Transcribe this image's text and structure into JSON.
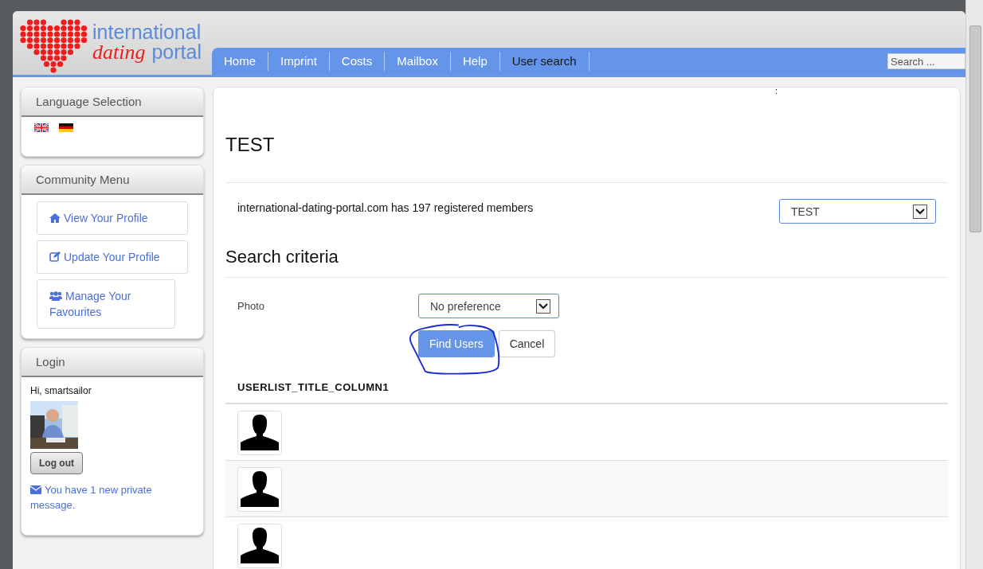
{
  "logo": {
    "line1": "international",
    "line2a": "dating",
    "line2b": "portal"
  },
  "nav": {
    "items": [
      {
        "label": "Home",
        "selected": false
      },
      {
        "label": "Imprint",
        "selected": false
      },
      {
        "label": "Costs",
        "selected": false
      },
      {
        "label": "Mailbox",
        "selected": false
      },
      {
        "label": "Help",
        "selected": false
      },
      {
        "label": "User search",
        "selected": true
      }
    ],
    "search": {
      "placeholder": "Search ..."
    }
  },
  "sidebar": {
    "language": {
      "title": "Language Selection",
      "flags": [
        {
          "kind": "uk"
        },
        {
          "kind": "de"
        }
      ]
    },
    "community": {
      "title": "Community Menu",
      "items": [
        {
          "label": "View Your Profile",
          "kind": "home"
        },
        {
          "label": "Update Your Profile",
          "kind": "edit"
        },
        {
          "label": "Manage Your Favourites",
          "kind": "users"
        }
      ]
    },
    "login": {
      "title": "Login",
      "greeting": "Hi, smartsailor",
      "logout": "Log out",
      "message": "You have 1 new private message."
    }
  },
  "main": {
    "stray_mark": ":",
    "title": "TEST",
    "members_text": "international-dating-portal.com has 197 registered members",
    "group_select": "TEST",
    "criteria_title": "Search criteria",
    "photo_label": "Photo",
    "photo_select": "No preference",
    "find_button": "Find Users",
    "cancel_button": "Cancel",
    "annotation": {
      "kind": "circle"
    },
    "userlist": {
      "column_1": "USERLIST_TITLE_COLUMN1",
      "rows": [
        {
          "kind": "default-avatar"
        },
        {
          "kind": "default-avatar"
        },
        {
          "kind": "default-avatar"
        }
      ]
    }
  }
}
